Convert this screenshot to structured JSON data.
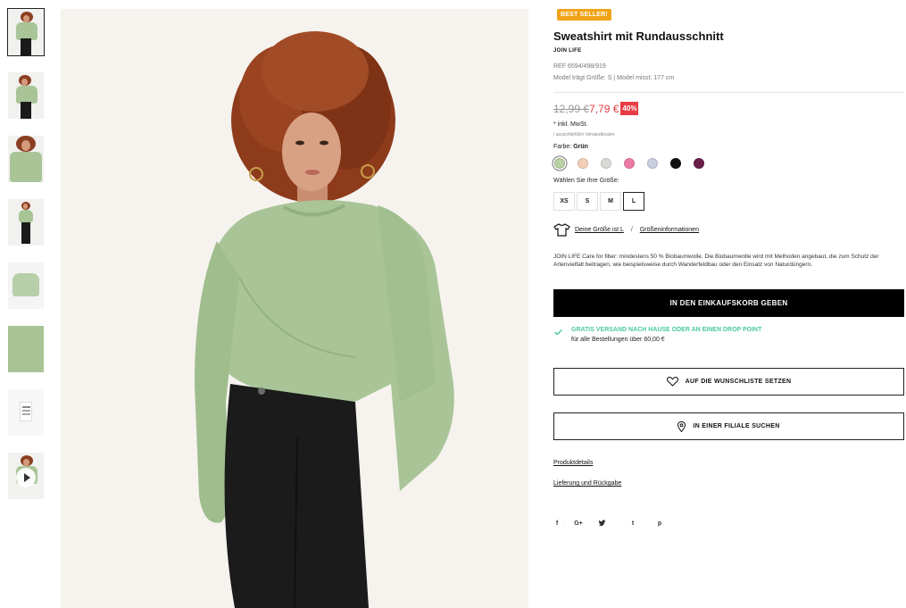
{
  "thumbnails": [
    {
      "name": "thumb-front",
      "icon": "product-photo"
    },
    {
      "name": "thumb-side",
      "icon": "product-photo"
    },
    {
      "name": "thumb-closeup",
      "icon": "product-photo"
    },
    {
      "name": "thumb-full",
      "icon": "product-photo"
    },
    {
      "name": "thumb-flat",
      "icon": "product-photo"
    },
    {
      "name": "thumb-fabric",
      "icon": "product-photo"
    },
    {
      "name": "thumb-label",
      "icon": "product-photo"
    },
    {
      "name": "thumb-video",
      "icon": "play-icon"
    }
  ],
  "product": {
    "badge": "BEST SELLER!",
    "title": "Sweatshirt mit Rundausschnitt",
    "brand": "JOIN LIFE",
    "ref": "REF 6594/498/919",
    "model": "Model trägt Größe: S | Model misst: 177 cm",
    "old_price": "12,99 €",
    "new_price": "7,79 €",
    "discount": "40%",
    "tax": "* inkl. MwSt.",
    "shipping_note": "/ ausschließlich Versandkosten",
    "color_label": "Farbe:",
    "color_name": "Grün",
    "swatches": [
      "#b9d1a3",
      "#f2cfb6",
      "#d9d9d6",
      "#ee7aa6",
      "#c9cfe1",
      "#111111",
      "#6a1f4a"
    ],
    "size_label": "Wählen Sie Ihre Größe:",
    "sizes": [
      "XS",
      "S",
      "M",
      "L"
    ],
    "selected_size": "L",
    "your_size_link": "Deine Größe ist L",
    "size_sep": "/",
    "size_info_link": "Größeninformationen",
    "description": "JOIN LIFE Care for fiber: mindestens 50 % Biobaumwolle. Die Biobaumwolle wird mit Methoden angebaut, die zum Schutz der Artenvielfalt beitragen, wie beispielsweise durch Wanderfeldbau oder den Einsatz von Naturdüngern.",
    "cart_button": "IN DEN EINKAUFSKORB GEBEN",
    "free_shipping_title": "GRATIS VERSAND NACH HAUSE ODER AN EINEN DROP POINT",
    "free_shipping_sub": "für alle Bestellungen über 60,00 €",
    "wishlist_button": "AUF DIE WUNSCHLISTE SETZEN",
    "store_button": "IN EINER FILIALE SUCHEN",
    "details_link": "Produktdetails",
    "returns_link": "Lieferung und Rückgabe",
    "social": [
      "f",
      "G+",
      "twitter",
      "t",
      "p"
    ]
  },
  "colors": {
    "badge": "#f0a317",
    "sale": "#e63c45",
    "free_shipping": "#4bc9a0",
    "sweatshirt": "#a9c598"
  }
}
